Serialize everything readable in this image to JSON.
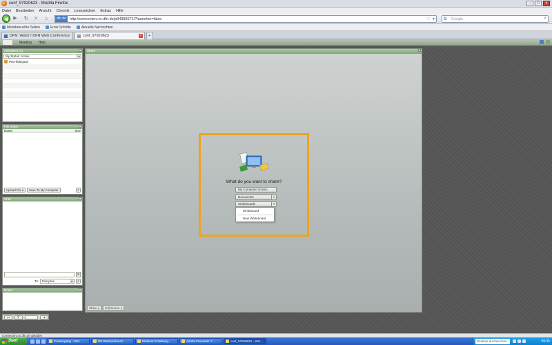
{
  "window": {
    "title": "conf_97920623 - Mozilla Firefox"
  },
  "menu": [
    "Datei",
    "Bearbeiten",
    "Ansicht",
    "Chronik",
    "Lesezeichen",
    "Extras",
    "Hilfe"
  ],
  "nav": {
    "site_badge": "dfn.de",
    "url": "http://connectsrv.vc.dfn.de/p94389671/?launcher=false",
    "search_placeholder": "Google"
  },
  "bookmarks": [
    "Meistbesuchte Seiten",
    "Erste Schritte",
    "Aktuelle Nachrichten"
  ],
  "tabs": [
    {
      "label": "DFN: Web2 / DFN Web Conference"
    },
    {
      "label": "conf_97920623"
    }
  ],
  "app_menu": [
    "Meeting",
    "Help"
  ],
  "panels": {
    "attendees": {
      "title": "Attendees (1)",
      "status": "My Status: Active",
      "me": "Pat Hildegard"
    },
    "files": {
      "title": "File Share",
      "col_name": "Name",
      "col_size": "Size",
      "upload": "Upload File",
      "save": "Save To My Computer"
    },
    "chat": {
      "title": "Chat",
      "to_label": "To:",
      "to_value": "Everyone"
    },
    "notes": {
      "title": "Notes"
    },
    "share": {
      "title": "Share",
      "bottom_btn1": "Share",
      "bottom_btn2": "Full Screen"
    }
  },
  "share_dialog": {
    "title": "What do you want to share?",
    "btn_computer": "My Computer Screen",
    "btn_documents": "Documents",
    "btn_whiteboard": "Whiteboards",
    "menu": [
      "Whiteboard",
      "New Whiteboard"
    ]
  },
  "statusbar": {
    "text": "connectsrv.vc.dfn.de geladen"
  },
  "taskbar": {
    "start": "Start",
    "tasks": [
      "Posteingang - Micr...",
      "DE:Webkonferenz",
      "Webinar Erstellung...",
      "Adobe Presenter 7...",
      "conf_97920623 - Moz..."
    ],
    "desktop": "Desktop durchsuchen",
    "clock": "09:35"
  },
  "colors": {
    "accent": "#f0a21e",
    "panel_header": "#8fb288",
    "taskbar": "#245bc2"
  }
}
